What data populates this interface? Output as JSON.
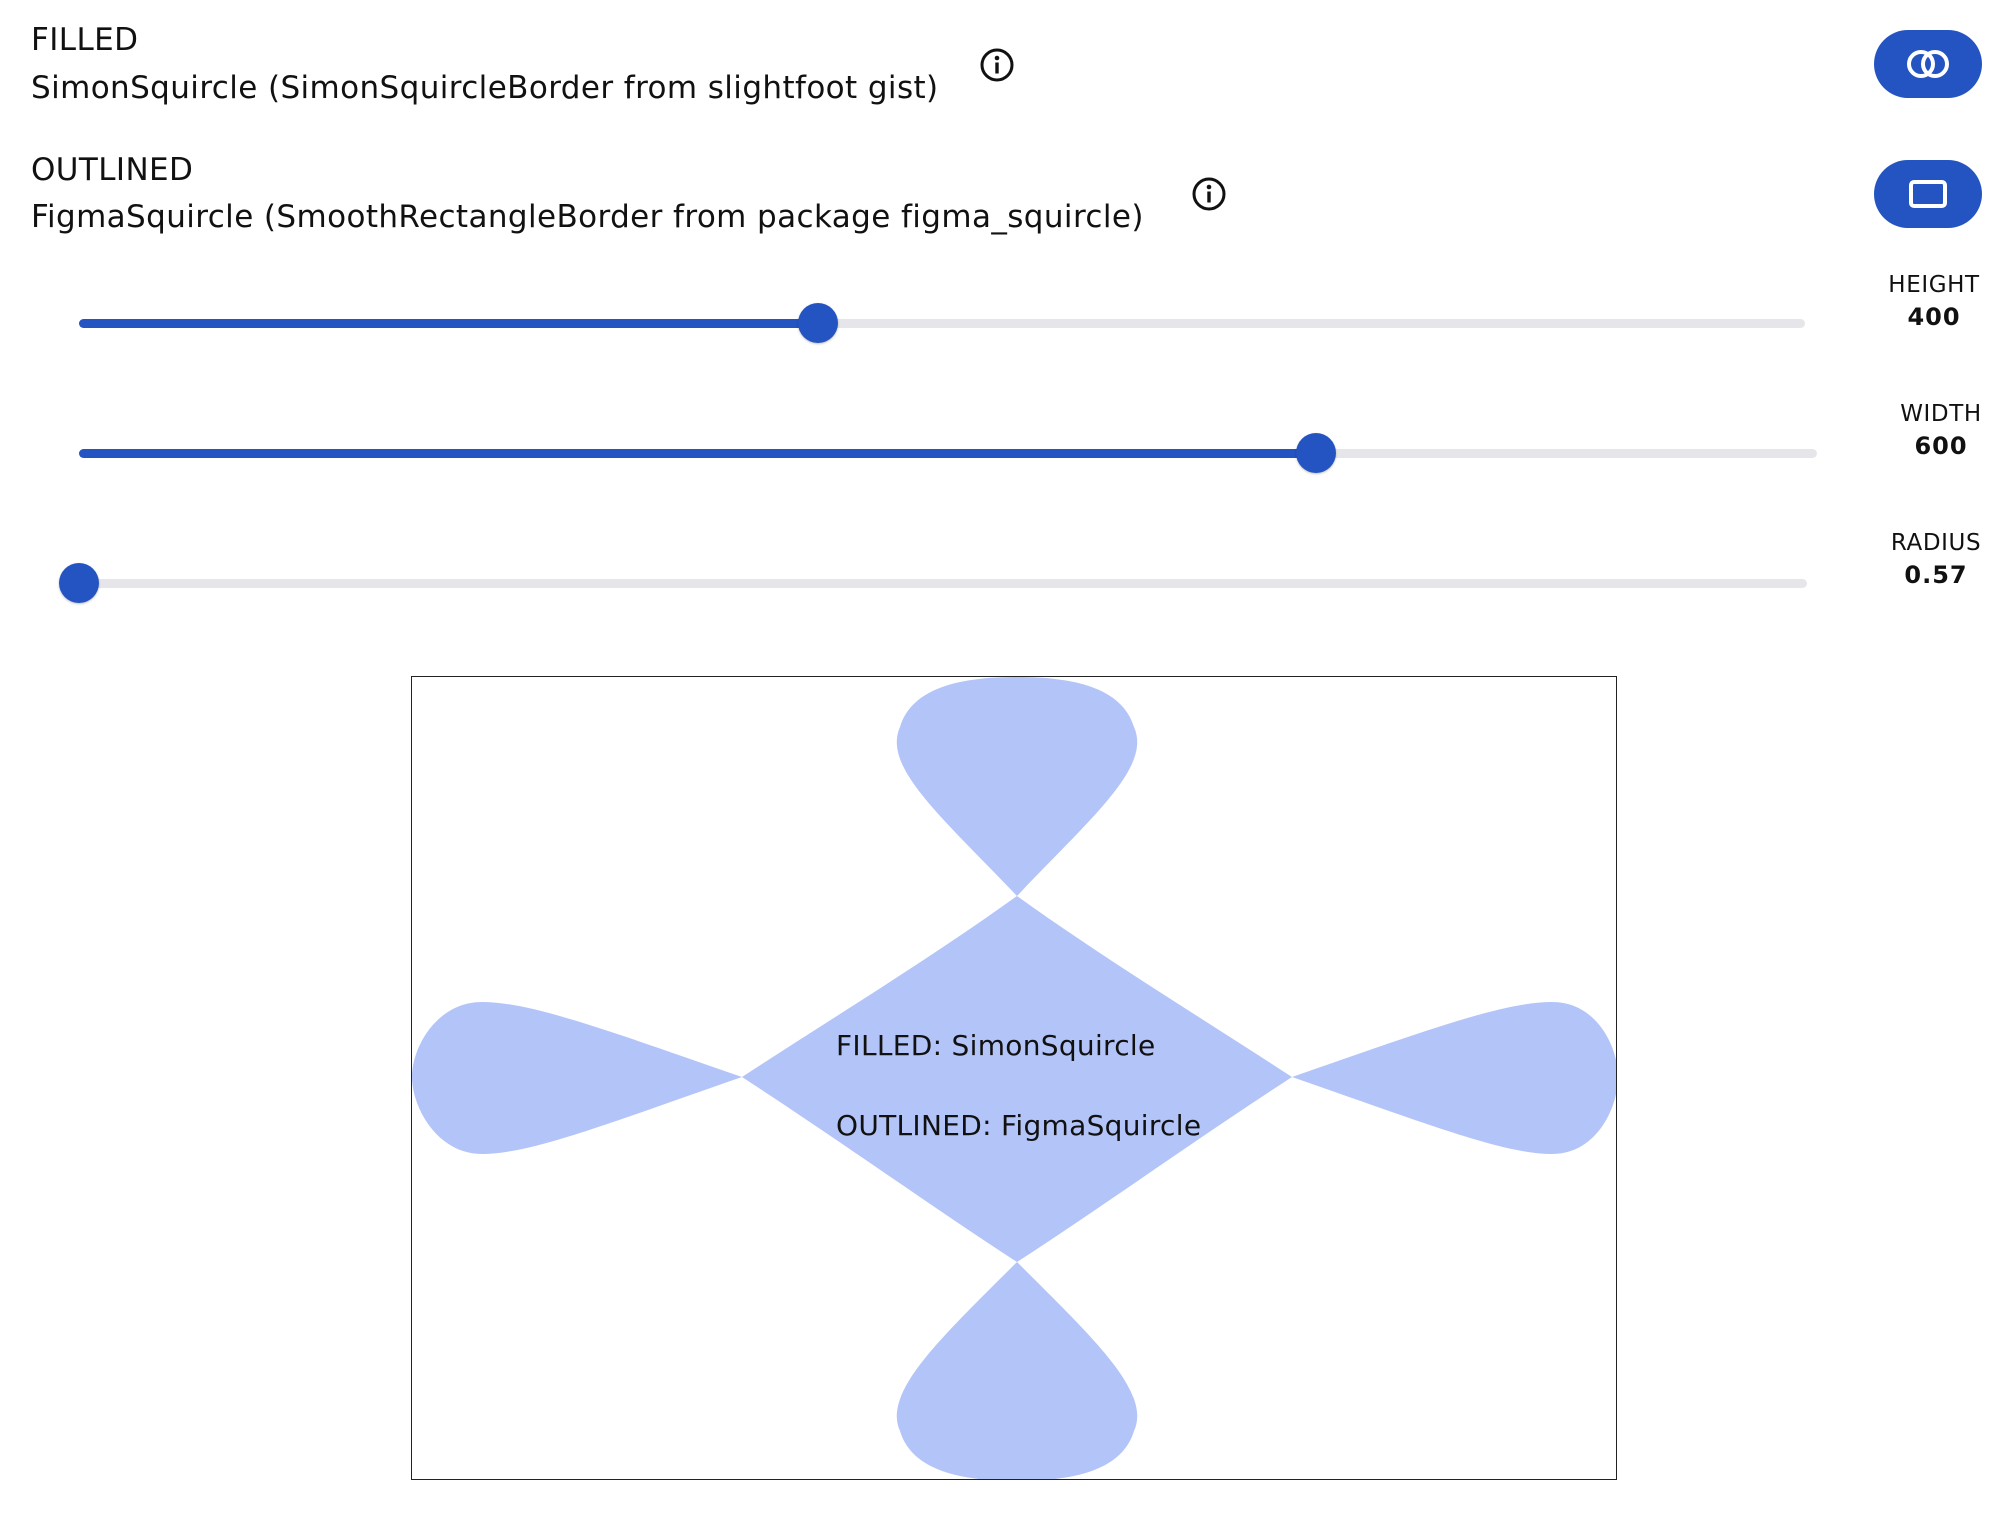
{
  "options": [
    {
      "heading": "FILLED",
      "description": "SimonSquircle (SimonSquircleBorder from slightfoot gist)",
      "button_icon": "overlap-circles-icon"
    },
    {
      "heading": "OUTLINED",
      "description": "FigmaSquircle (SmoothRectangleBorder from package figma_squircle)",
      "button_icon": "rounded-rect-icon"
    }
  ],
  "controls": {
    "height": {
      "label": "HEIGHT",
      "value": "400",
      "fraction": 0.428
    },
    "width": {
      "label": "WIDTH",
      "value": "600",
      "fraction": 0.712
    },
    "radius": {
      "label": "RADIUS",
      "value": "0.57",
      "fraction": 0.0
    }
  },
  "preview": {
    "filled_text": "FILLED: SimonSquircle",
    "outlined_text": "OUTLINED: FigmaSquircle",
    "fill_color": "#b3c4f8"
  },
  "colors": {
    "accent": "#2454c2",
    "track": "#e6e6ea"
  }
}
